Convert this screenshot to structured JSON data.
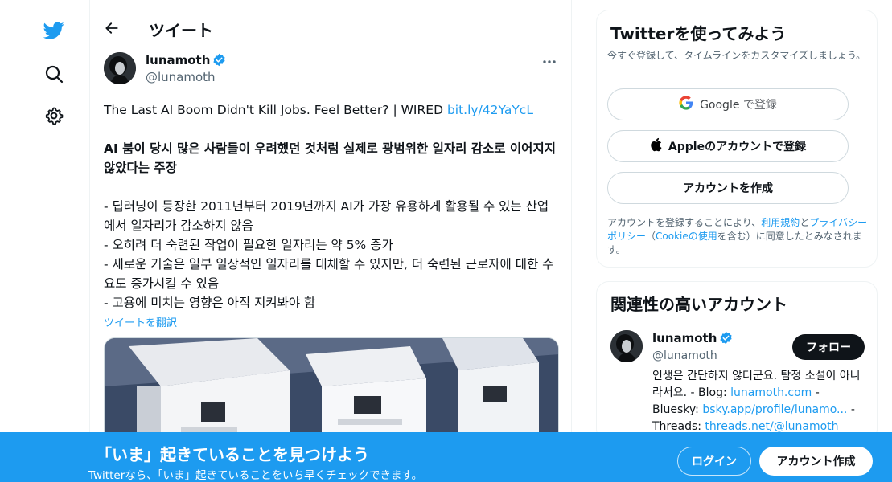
{
  "nav": {
    "icons": [
      "twitter-bird-icon",
      "search-icon",
      "gear-icon"
    ]
  },
  "header": {
    "title": "ツイート"
  },
  "tweet": {
    "author_name": "lunamoth",
    "author_handle": "@lunamoth",
    "line1_text": "The Last AI Boom Didn't Kill Jobs. Feel Better? | WIRED ",
    "line1_link": "bit.ly/42YaYcL",
    "headline": "AI 붐이 당시 많은 사람들이 우려했던 것처럼 실제로 광범위한 일자리 감소로 이어지지 않았다는 주장",
    "bullet1": "- 딥러닝이 등장한 2011년부터 2019년까지 AI가 가장 유용하게 활용될 수 있는 산업에서 일자리가 감소하지 않음",
    "bullet2": "- 오히려 더 숙련된 작업이 필요한 일자리는 약 5% 증가",
    "bullet3": "- 새로운 기술은 일부 일상적인 일자리를 대체할 수 있지만, 더 숙련된 근로자에 대한 수요도 증가시킬 수 있음",
    "bullet4": "- 고용에 미치는 영향은 아직 지켜봐야 함",
    "translate": "ツイートを翻訳"
  },
  "signup": {
    "title": "Twitterを使ってみよう",
    "subtitle": "今すぐ登録して、タイムラインをカスタマイズしましょう。",
    "google_brand": "Google",
    "google_suffix": " で登録",
    "apple_label": "Appleのアカウントで登録",
    "create_label": "アカウントを作成",
    "terms_pre": "アカウントを登録することにより、",
    "terms_link1": "利用規約",
    "terms_mid1": "と",
    "terms_link2": "プライバシーポリシー",
    "terms_mid2": "（",
    "terms_link3": "Cookieの使用",
    "terms_post": "を含む）に同意したとみなされます。"
  },
  "related": {
    "title": "関連性の高いアカウント",
    "name": "lunamoth",
    "handle": "@lunamoth",
    "follow_label": "フォロー",
    "bio_text1": "인생은 간단하지 않더군요. 탐정 소설이 아니라서요. - Blog: ",
    "bio_link1": "lunamoth.com",
    "bio_text2": " - Bluesky: ",
    "bio_link2": "bsky.app/profile/lunamo...",
    "bio_text3": " - Threads: ",
    "bio_link3": "threads.net/@lunamoth"
  },
  "banner": {
    "title": "「いま」起きていることを見つけよう",
    "subtitle": "Twitterなら、「いま」起きていることをいち早くチェックできます。",
    "login_label": "ログイン",
    "create_label": "アカウント作成"
  },
  "colors": {
    "accent": "#1d9bf0",
    "text": "#0f1419",
    "muted": "#536471"
  }
}
